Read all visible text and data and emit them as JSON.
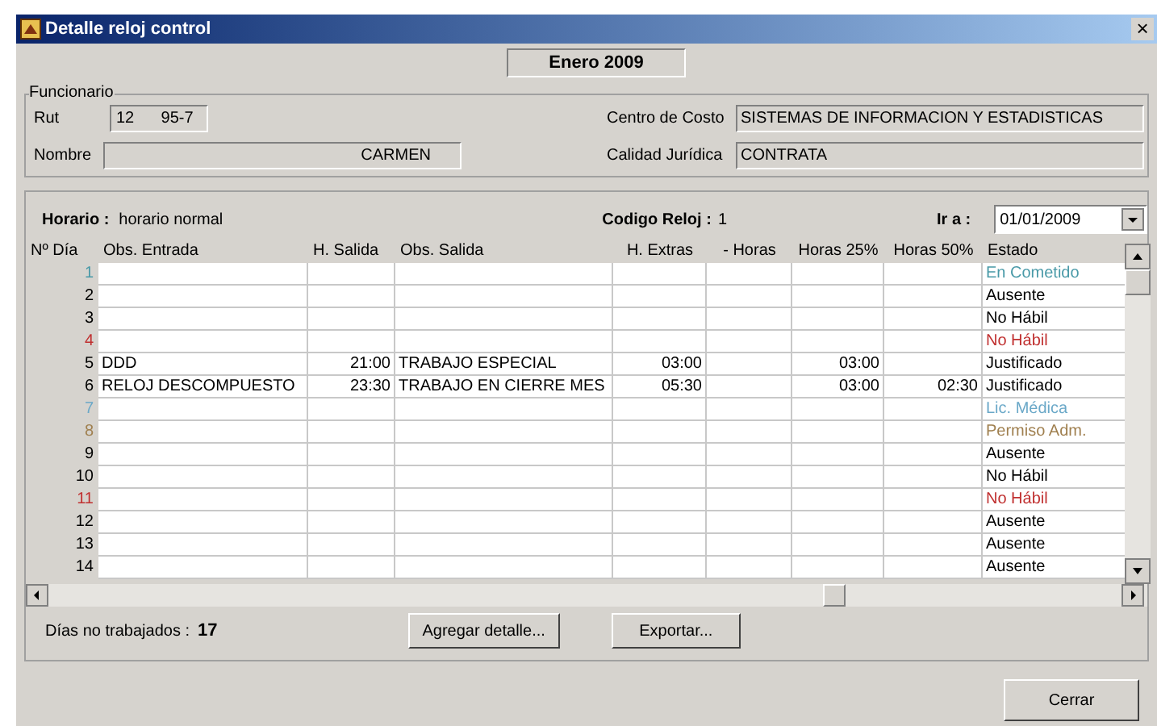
{
  "window": {
    "title": "Detalle reloj control",
    "close": "×"
  },
  "period": "Enero 2009",
  "funcionario": {
    "legend": "Funcionario",
    "rut": {
      "label": "Rut",
      "value": "12      95-7"
    },
    "nombre": {
      "label": "Nombre",
      "value": "CARMEN"
    },
    "centro_costo": {
      "label": "Centro de Costo",
      "value": "SISTEMAS DE INFORMACION Y ESTADISTICAS"
    },
    "calidad_juridica": {
      "label": "Calidad Jurídica",
      "value": "CONTRATA"
    }
  },
  "horario": {
    "label": "Horario :",
    "value": "horario normal"
  },
  "codigo_reloj": {
    "label": "Codigo Reloj :",
    "value": "1"
  },
  "ir_a": {
    "label": "Ir a :",
    "value": "01/01/2009"
  },
  "table": {
    "columns": [
      "Nº Día",
      "Obs. Entrada",
      "H. Salida",
      "Obs. Salida",
      "H. Extras",
      "- Horas",
      "Horas 25%",
      "Horas 50%",
      "Estado"
    ],
    "rows": [
      {
        "color": "#4a9aa8",
        "cells": [
          "1",
          "",
          "",
          "",
          "",
          "",
          "",
          "",
          "En Cometido"
        ]
      },
      {
        "color": "#000000",
        "cells": [
          "2",
          "",
          "",
          "",
          "",
          "",
          "",
          "",
          "Ausente"
        ]
      },
      {
        "color": "#000000",
        "cells": [
          "3",
          "",
          "",
          "",
          "",
          "",
          "",
          "",
          "No Hábil"
        ]
      },
      {
        "color": "#c03030",
        "cells": [
          "4",
          "",
          "",
          "",
          "",
          "",
          "",
          "",
          "No Hábil"
        ]
      },
      {
        "color": "#000000",
        "cells": [
          "5",
          "DDD",
          "21:00",
          "TRABAJO ESPECIAL",
          "03:00",
          "",
          "03:00",
          "",
          "Justificado"
        ]
      },
      {
        "color": "#000000",
        "cells": [
          "6",
          "RELOJ DESCOMPUESTO",
          "23:30",
          "TRABAJO EN CIERRE MES",
          "05:30",
          "",
          "03:00",
          "02:30",
          "Justificado"
        ]
      },
      {
        "color": "#6aa8c8",
        "cells": [
          "7",
          "",
          "",
          "",
          "",
          "",
          "",
          "",
          "Lic. Médica"
        ]
      },
      {
        "color": "#a08050",
        "cells": [
          "8",
          "",
          "",
          "",
          "",
          "",
          "",
          "",
          "Permiso Adm."
        ]
      },
      {
        "color": "#000000",
        "cells": [
          "9",
          "",
          "",
          "",
          "",
          "",
          "",
          "",
          "Ausente"
        ]
      },
      {
        "color": "#000000",
        "cells": [
          "10",
          "",
          "",
          "",
          "",
          "",
          "",
          "",
          "No Hábil"
        ]
      },
      {
        "color": "#c03030",
        "cells": [
          "11",
          "",
          "",
          "",
          "",
          "",
          "",
          "",
          "No Hábil"
        ]
      },
      {
        "color": "#000000",
        "cells": [
          "12",
          "",
          "",
          "",
          "",
          "",
          "",
          "",
          "Ausente"
        ]
      },
      {
        "color": "#000000",
        "cells": [
          "13",
          "",
          "",
          "",
          "",
          "",
          "",
          "",
          "Ausente"
        ]
      },
      {
        "color": "#000000",
        "cells": [
          "14",
          "",
          "",
          "",
          "",
          "",
          "",
          "",
          "Ausente"
        ]
      }
    ]
  },
  "dias_no_trabajados": {
    "label": "Días no trabajados :",
    "value": "17"
  },
  "buttons": [
    "Agregar detalle...",
    "Exportar..."
  ],
  "close_button": "Cerrar"
}
